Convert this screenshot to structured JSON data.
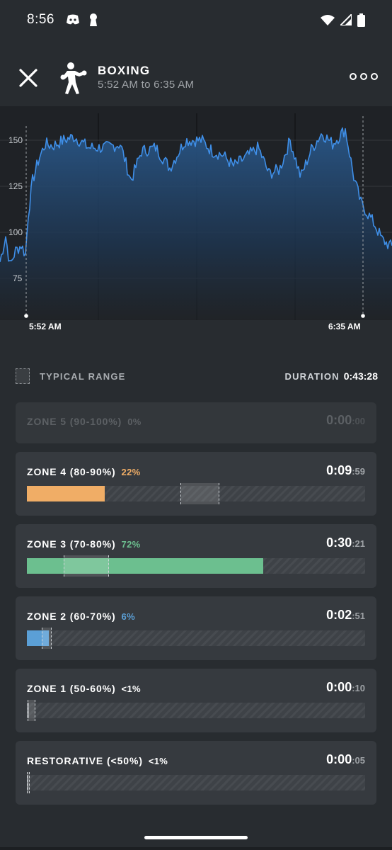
{
  "status_bar": {
    "time": "8:56",
    "left_icons": [
      "discord-icon",
      "keyhole-icon"
    ],
    "right_icons": [
      "wifi-icon",
      "signal-icon",
      "battery-icon"
    ]
  },
  "header": {
    "activity": "BOXING",
    "time_range": "5:52 AM to 6:35 AM",
    "activity_icon": "boxing-figure-icon",
    "close_icon": "close-icon",
    "more_icon": "more-dots-icon"
  },
  "chart": {
    "y_ticks": [
      "150",
      "125",
      "100",
      "75"
    ],
    "start_label": "5:52 AM",
    "end_label": "6:35 AM",
    "line_color": "#3f8fe8"
  },
  "legend": {
    "typical_range_label": "TYPICAL RANGE",
    "duration_label": "DURATION",
    "duration_value": "0:43:28"
  },
  "zones": [
    {
      "name": "ZONE 5 (90-100%)",
      "pct": "0%",
      "time_main": "0:00",
      "time_sec": ":00",
      "dim": true
    },
    {
      "name": "ZONE 4 (80-90%)",
      "pct": "22%",
      "time_main": "0:09",
      "time_sec": ":59",
      "color": "#f0ad66",
      "fill_fraction": 0.23,
      "typical_range": [
        0.455,
        0.57
      ]
    },
    {
      "name": "ZONE 3 (70-80%)",
      "pct": "72%",
      "time_main": "0:30",
      "time_sec": ":21",
      "color": "#6cbf8f",
      "fill_fraction": 0.698,
      "typical_range": [
        0.108,
        0.243
      ]
    },
    {
      "name": "ZONE 2 (60-70%)",
      "pct": "6%",
      "time_main": "0:02",
      "time_sec": ":51",
      "color": "#5b9fd6",
      "fill_fraction": 0.065,
      "typical_range": [
        0.044,
        0.073
      ]
    },
    {
      "name": "ZONE 1 (50-60%)",
      "pct": "<1%",
      "time_main": "0:00",
      "time_sec": ":10",
      "color": "#8a8e92",
      "fill_fraction": 0.006,
      "typical_range": [
        0.002,
        0.026
      ]
    },
    {
      "name": "RESTORATIVE (<50%)",
      "pct": "<1%",
      "time_main": "0:00",
      "time_sec": ":05",
      "color": "#8a8e92",
      "fill_fraction": 0.003,
      "typical_range": [
        0.0,
        0.006
      ]
    }
  ]
}
